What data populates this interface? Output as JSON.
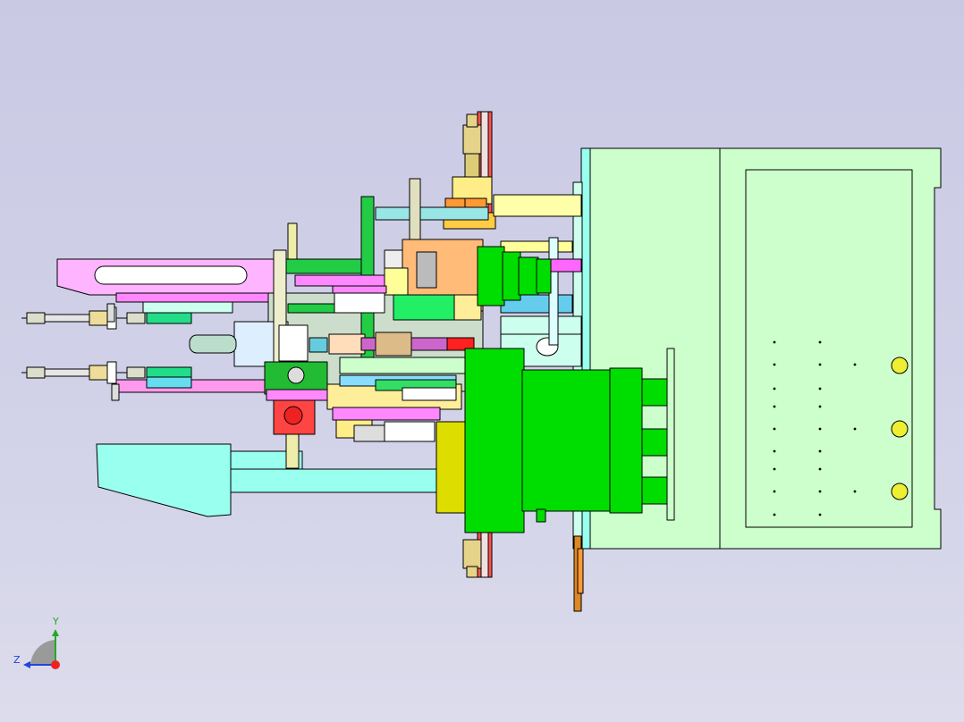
{
  "triad": {
    "y_label": "Y",
    "z_label": "Z"
  },
  "colors": {
    "background": "#cfcfe6",
    "plate": "#ccffcc",
    "outline": "#000000",
    "green": "#00e000",
    "yellow": "#dddd00",
    "pink": "#ffb4ff",
    "cyan": "#99ffff",
    "orange": "#ffc080",
    "red": "#ff3030",
    "magenta": "#ff40ff"
  }
}
